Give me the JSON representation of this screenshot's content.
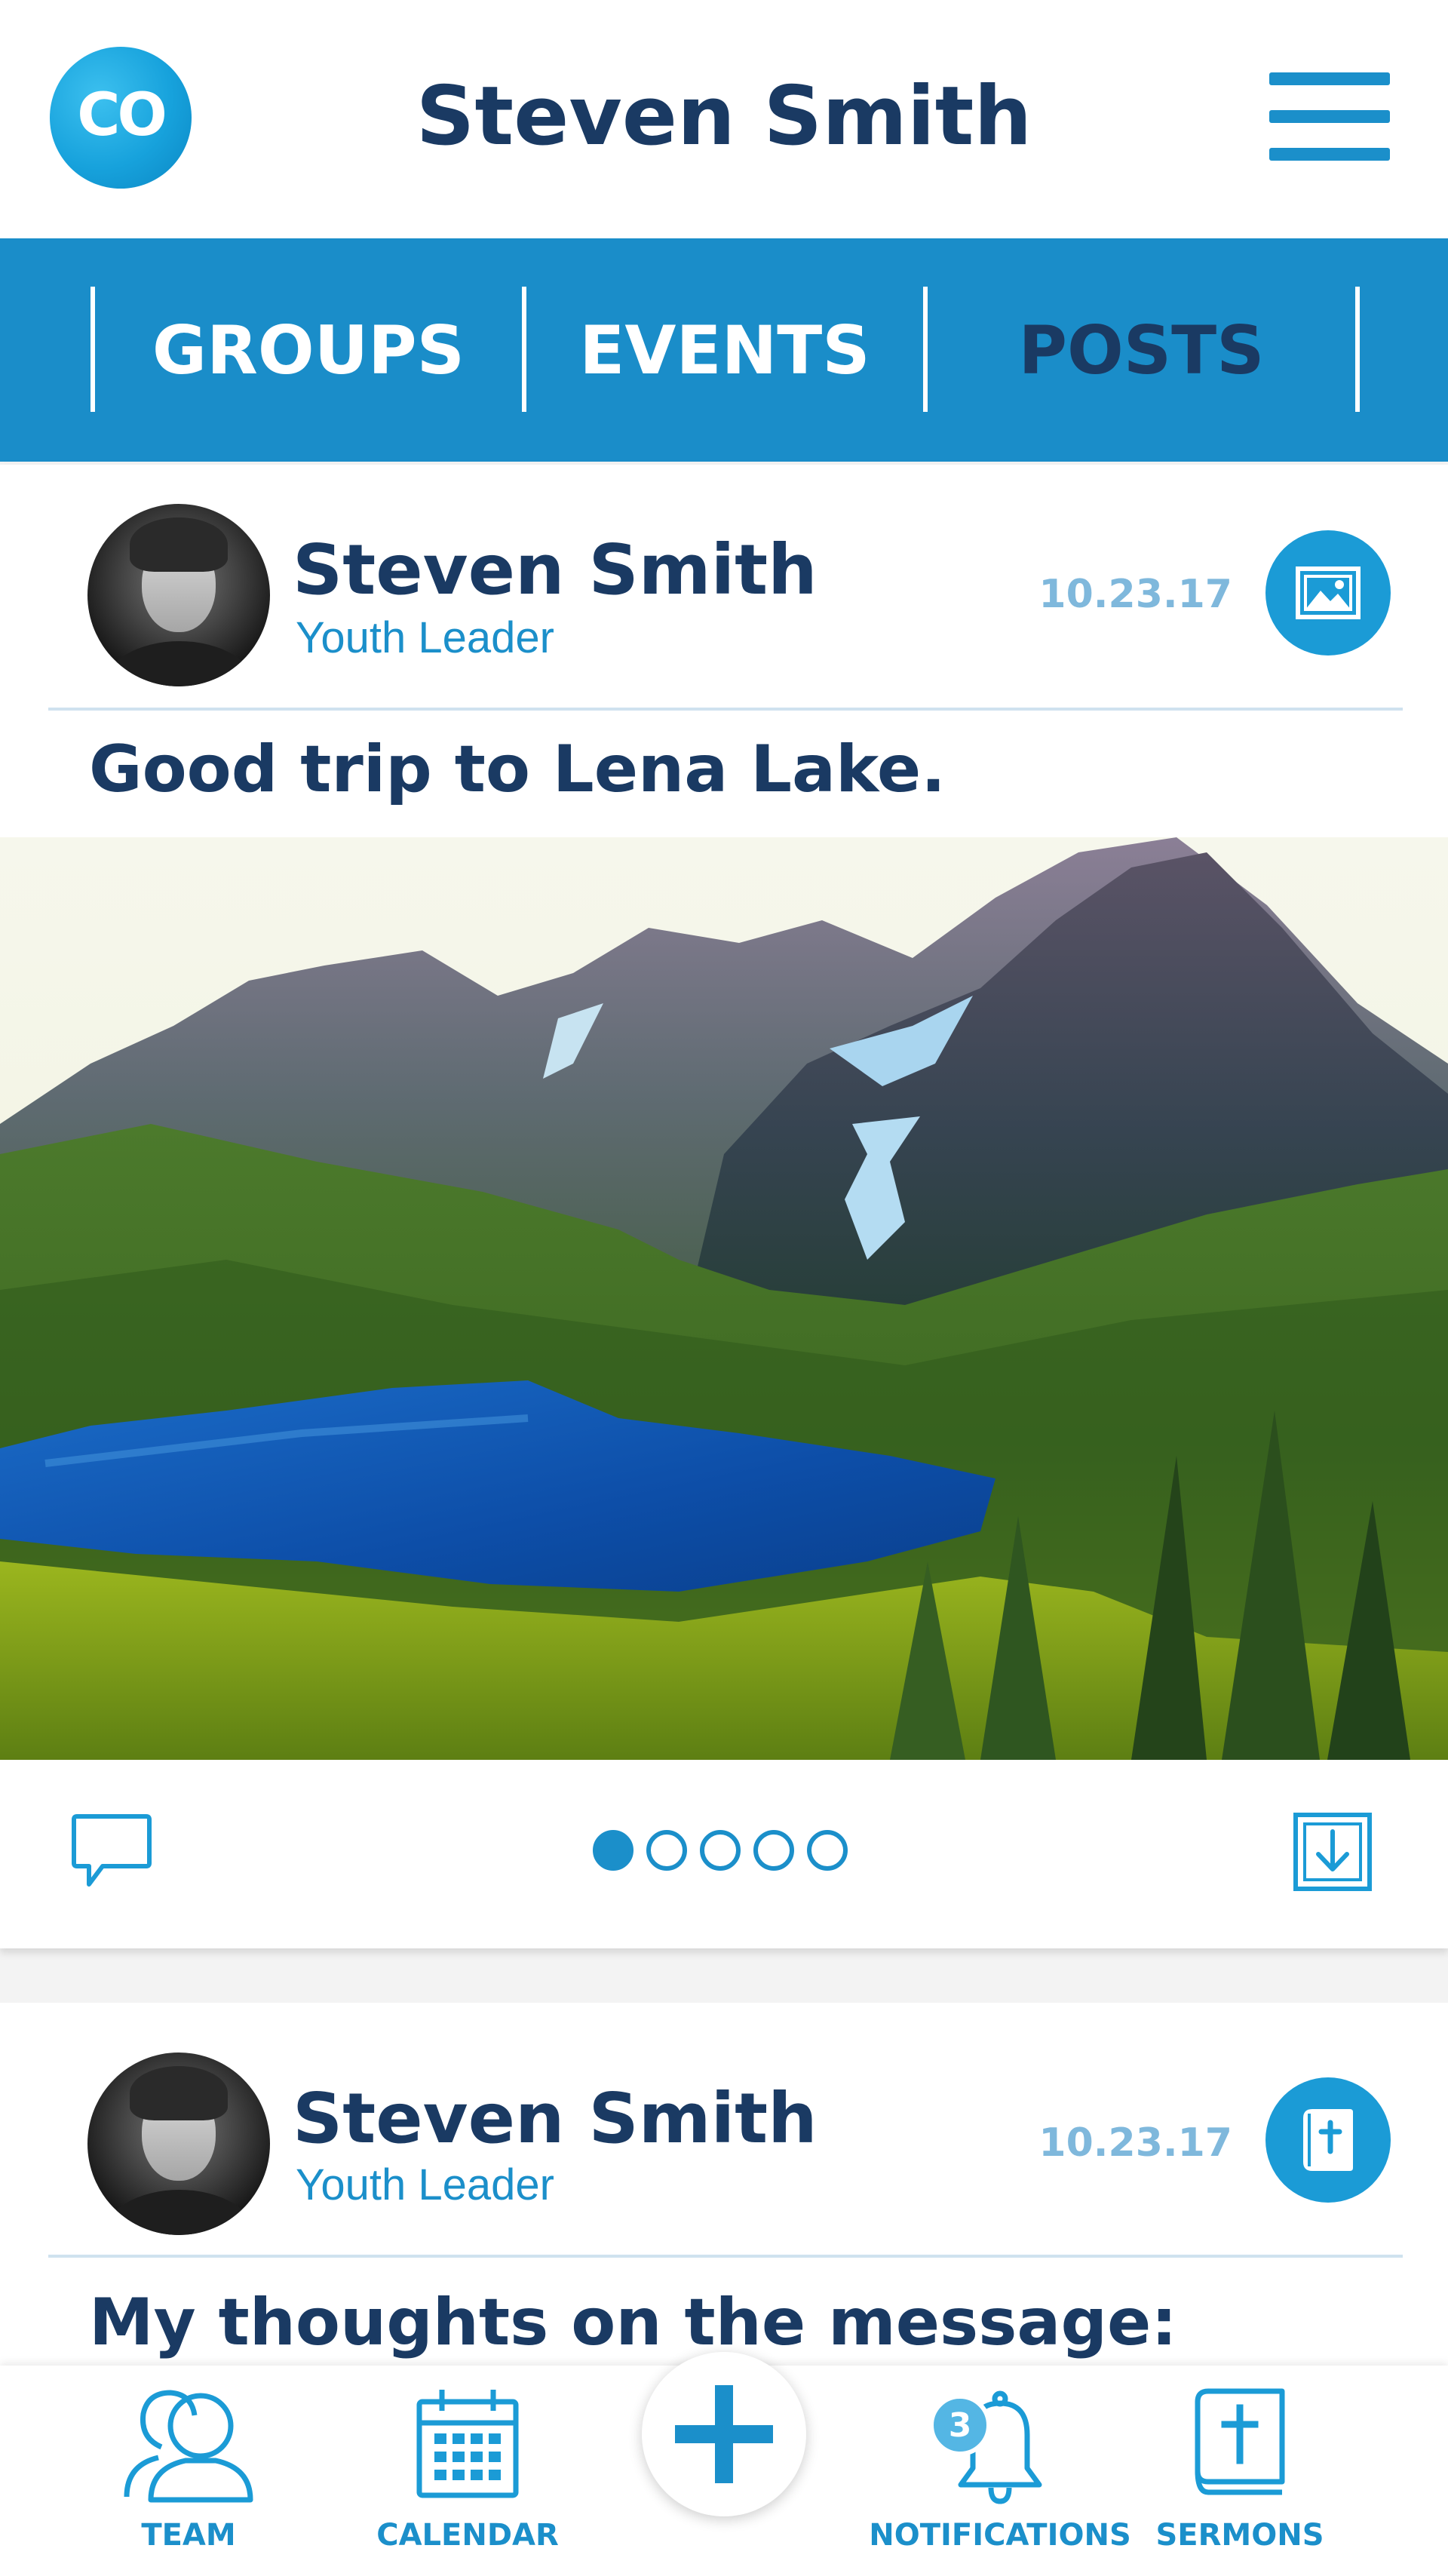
{
  "header": {
    "logo_text": "CO",
    "title": "Steven Smith",
    "menu_icon": "hamburger-icon"
  },
  "tabs": [
    {
      "label": "GROUPS",
      "active": false
    },
    {
      "label": "EVENTS",
      "active": false
    },
    {
      "label": "POSTS",
      "active": true
    }
  ],
  "posts": [
    {
      "author": "Steven Smith",
      "role": "Youth Leader",
      "date": "10.23.17",
      "type_icon": "image-icon",
      "title": "Good trip to Lena Lake.",
      "photo_icon": "landscape-photo",
      "carousel_total": 5,
      "carousel_active_index": 0,
      "actions": {
        "comment_icon": "comment-icon",
        "save_icon": "download-icon"
      }
    },
    {
      "author": "Steven Smith",
      "role": "Youth Leader",
      "date": "10.23.17",
      "type_icon": "sermon-notes-icon",
      "title": "My thoughts on the message:"
    }
  ],
  "bottom_nav": {
    "items": [
      {
        "label": "TEAM",
        "icon": "team-icon"
      },
      {
        "label": "CALENDAR",
        "icon": "calendar-icon"
      },
      {
        "label": "NOTIFICATIONS",
        "icon": "bell-icon",
        "badge": "3"
      },
      {
        "label": "SERMONS",
        "icon": "bible-icon"
      }
    ],
    "add_icon": "plus-icon"
  },
  "colors": {
    "primary": "#1a8dc9",
    "navy": "#1a3a63",
    "date": "#7fb8dc"
  }
}
